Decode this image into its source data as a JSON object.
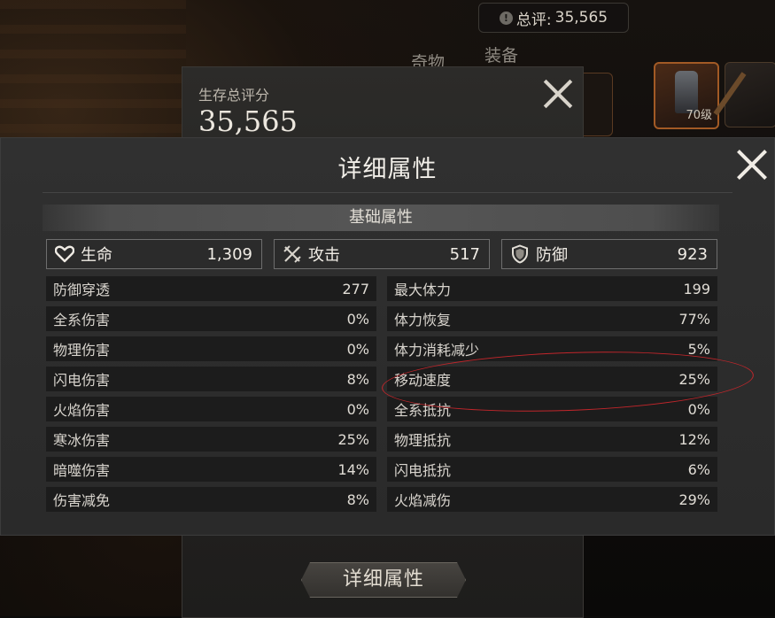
{
  "header": {
    "total_score_label": "总评:",
    "total_score_value": "35,565",
    "tabs": [
      "奇物",
      "装备"
    ]
  },
  "equipment": {
    "slot_level": "70级"
  },
  "back_panel": {
    "title": "生存总评分",
    "score": "35,565",
    "detail_button": "详细属性"
  },
  "modal": {
    "title": "详细属性",
    "section": "基础属性",
    "main_stats": [
      {
        "label": "生命",
        "value": "1,309",
        "icon": "heart-icon"
      },
      {
        "label": "攻击",
        "value": "517",
        "icon": "swords-icon"
      },
      {
        "label": "防御",
        "value": "923",
        "icon": "shield-icon"
      }
    ],
    "left_stats": [
      {
        "label": "防御穿透",
        "value": "277"
      },
      {
        "label": "全系伤害",
        "value": "0%"
      },
      {
        "label": "物理伤害",
        "value": "0%"
      },
      {
        "label": "闪电伤害",
        "value": "8%"
      },
      {
        "label": "火焰伤害",
        "value": "0%"
      },
      {
        "label": "寒冰伤害",
        "value": "25%"
      },
      {
        "label": "暗噬伤害",
        "value": "14%"
      },
      {
        "label": "伤害减免",
        "value": "8%"
      }
    ],
    "right_stats": [
      {
        "label": "最大体力",
        "value": "199"
      },
      {
        "label": "体力恢复",
        "value": "77%"
      },
      {
        "label": "体力消耗减少",
        "value": "5%"
      },
      {
        "label": "移动速度",
        "value": "25%"
      },
      {
        "label": "全系抵抗",
        "value": "0%"
      },
      {
        "label": "物理抵抗",
        "value": "12%"
      },
      {
        "label": "闪电抵抗",
        "value": "6%"
      },
      {
        "label": "火焰减伤",
        "value": "29%"
      }
    ]
  },
  "colors": {
    "annotation": "#c2262b",
    "modal_bg": "#2e2e2e",
    "row_bg": "#1c1c1c"
  }
}
